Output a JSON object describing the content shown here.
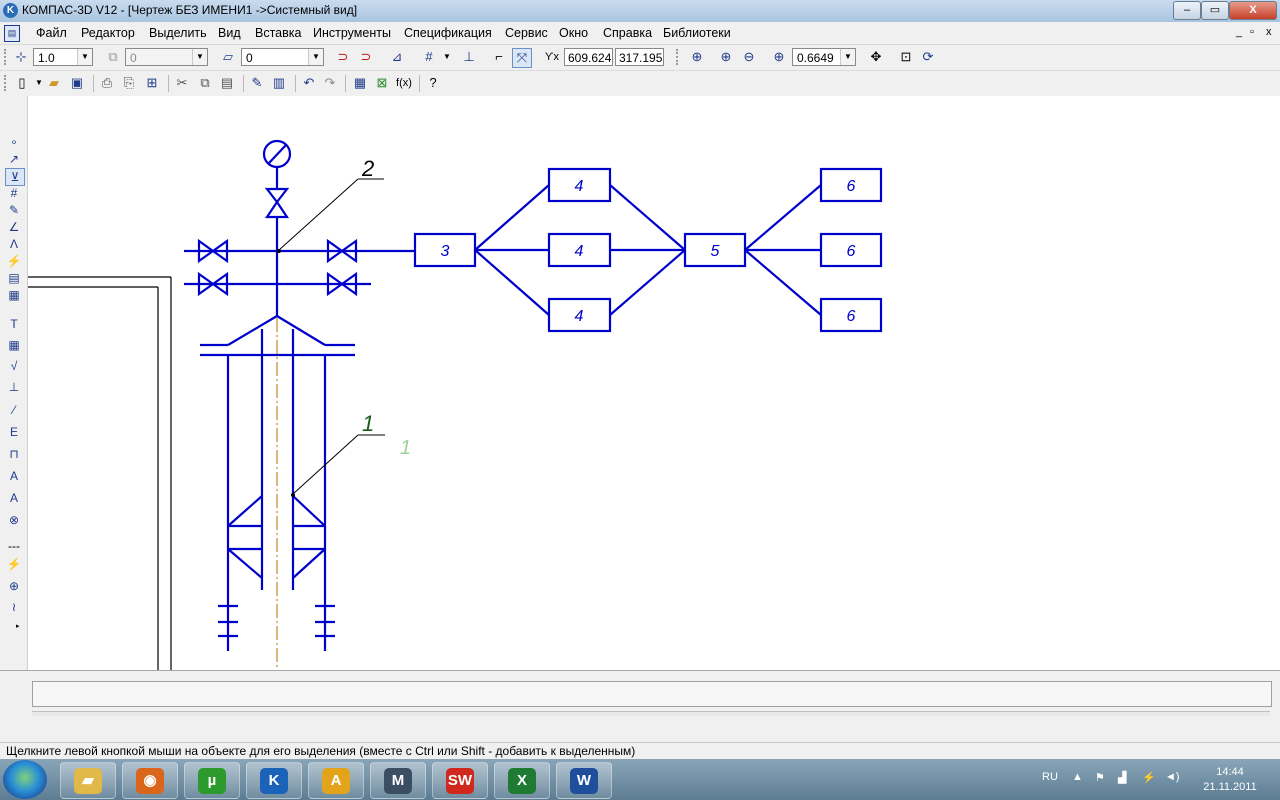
{
  "window": {
    "title": "КОМПАС-3D V12 - [Чертеж БЕЗ ИМЕНИ1 ->Системный вид]",
    "minimize": "–",
    "maximize": "▭",
    "close": "X"
  },
  "menu": {
    "items": [
      "Файл",
      "Редактор",
      "Выделить",
      "Вид",
      "Вставка",
      "Инструменты",
      "Спецификация",
      "Сервис",
      "Окно",
      "Справка",
      "Библиотеки"
    ],
    "mdi_min": "_",
    "mdi_restore": "▫",
    "mdi_close": "x"
  },
  "toolbar1": {
    "scale_value": "1.0",
    "layer_value": "0",
    "style_value": "0",
    "coord_x": "609.624",
    "coord_y": "317.195",
    "zoom_value": "0.6649"
  },
  "drawing": {
    "accent_color": "#0000cc",
    "axis_color": "#c89a4a",
    "leader_color": "#000000",
    "callout_color": "#1a5c1a",
    "ghost_color": "#9ed29a",
    "labels": {
      "box3": "3",
      "box4_top": "4",
      "box4_mid": "4",
      "box4_bot": "4",
      "box5": "5",
      "box6_top": "6",
      "box6_mid": "6",
      "box6_bot": "6",
      "callout2": "2",
      "callout1": "1",
      "ghost1": "1"
    }
  },
  "status": {
    "hint": "Щелкните левой кнопкой мыши на объекте для его выделения (вместе с Ctrl или Shift - добавить к выделенным)"
  },
  "taskbar": {
    "apps": [
      {
        "name": "explorer",
        "icon": "folder-icon",
        "color": "#e2b84a"
      },
      {
        "name": "firefox",
        "icon": "firefox-icon",
        "color": "#d9661a"
      },
      {
        "name": "utorrent",
        "icon": "utorrent-icon",
        "color": "#2c9a2c"
      },
      {
        "name": "kompas",
        "icon": "kompas-icon",
        "color": "#1a63b8"
      },
      {
        "name": "archicad",
        "icon": "archicad-icon",
        "color": "#e3a41c"
      },
      {
        "name": "mathcad",
        "icon": "mathcad-icon",
        "color": "#3b4e63"
      },
      {
        "name": "solidworks",
        "icon": "solidworks-icon",
        "color": "#d0281c"
      },
      {
        "name": "excel",
        "icon": "excel-icon",
        "color": "#1f7a34"
      },
      {
        "name": "word",
        "icon": "word-icon",
        "color": "#1f4f9a"
      }
    ],
    "lang": "RU",
    "time": "14:44",
    "date": "21.11.2011"
  }
}
